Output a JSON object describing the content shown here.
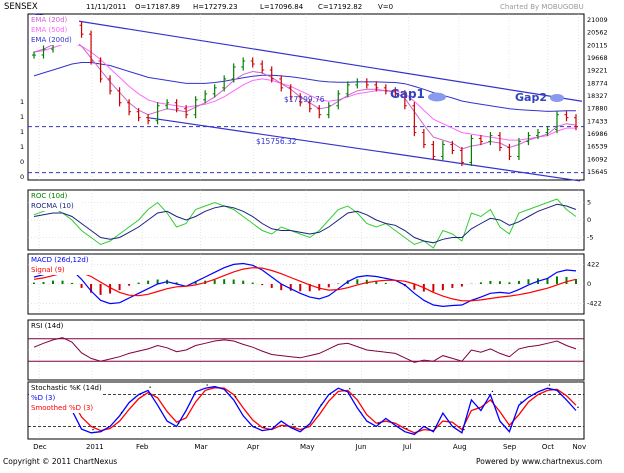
{
  "header": {
    "symbol": "SENSEX",
    "date": "11/11/2011",
    "open": "O=17187.89",
    "high": "H=17279.23",
    "low": "L=17096.84",
    "close": "C=17192.82",
    "volume": "V=0",
    "credit": "Charted By MOBUGOBU"
  },
  "footer": {
    "copyright": "Copyright © 2011 ChartNexus",
    "powered": "Powered by www.chartnexus.com"
  },
  "colors": {
    "price_up": "#008000",
    "price_down": "#cc0000",
    "ema20": "#cc66cc",
    "ema50": "#ff66ff",
    "ema200": "#3333cc",
    "trendline": "#3333cc",
    "roc": "#33cc33",
    "rocma": "#1a237e",
    "macd": "#0000ff",
    "signal": "#ff0000",
    "rsi": "#800040",
    "stoch_k": "#0000ff",
    "stoch_d": "#ff0000",
    "gap_marker": "#8899ee"
  },
  "chart_data": [
    {
      "type": "line",
      "panel": "price",
      "title": "SENSEX",
      "legend": [
        "EMA (20d)",
        "EMA (50d)",
        "EMA (200d)"
      ],
      "yticks": [
        "21009",
        "20562",
        "20115",
        "19668",
        "19221",
        "18774",
        "18327",
        "17880",
        "17433",
        "16986",
        "16539",
        "16092",
        "15645"
      ],
      "ylim": [
        15645,
        21009
      ],
      "left_ticks": [
        "1",
        "1",
        "1",
        "1",
        "0",
        "0"
      ],
      "xticks": [
        "Dec",
        "2011",
        "Feb",
        "Mar",
        "Apr",
        "May",
        "Jun",
        "Jul",
        "Aug",
        "Sep",
        "Oct",
        "Nov"
      ],
      "annotations": [
        "Gap1",
        "Gap2",
        "$17299.76",
        "$15756.32"
      ],
      "levels": [
        17299.76,
        15756.32
      ],
      "close": [
        19700,
        19900,
        20200,
        20500,
        20700,
        20400,
        19500,
        18900,
        18500,
        18100,
        17800,
        17600,
        17500,
        18000,
        18100,
        17900,
        17700,
        18200,
        18400,
        18600,
        18900,
        19300,
        19500,
        19400,
        19200,
        18900,
        18600,
        18300,
        18100,
        17900,
        17700,
        18000,
        18400,
        18700,
        18800,
        18700,
        18600,
        18500,
        18400,
        18000,
        17100,
        16700,
        16300,
        16700,
        16500,
        16100,
        16900,
        16800,
        17000,
        16600,
        16300,
        16800,
        17000,
        17100,
        17200,
        17700,
        17600,
        17300
      ],
      "ema20": [
        19800,
        19900,
        20050,
        20200,
        20250,
        20000,
        19600,
        19200,
        18800,
        18450,
        18100,
        17850,
        17700,
        17800,
        17900,
        17850,
        17800,
        17950,
        18100,
        18300,
        18550,
        18850,
        19050,
        19150,
        19100,
        18950,
        18750,
        18550,
        18300,
        18100,
        17900,
        17950,
        18150,
        18350,
        18500,
        18550,
        18550,
        18500,
        18450,
        18250,
        17800,
        17350,
        16950,
        16850,
        16750,
        16550,
        16650,
        16700,
        16800,
        16750,
        16600,
        16700,
        16850,
        16950,
        17050,
        17300,
        17400,
        17350
      ],
      "ema50": [
        19800,
        19850,
        19950,
        20050,
        20100,
        20000,
        19800,
        19550,
        19250,
        18950,
        18650,
        18400,
        18200,
        18100,
        18050,
        18000,
        17950,
        18000,
        18050,
        18150,
        18300,
        18500,
        18700,
        18850,
        18900,
        18850,
        18750,
        18650,
        18500,
        18350,
        18200,
        18150,
        18200,
        18300,
        18400,
        18450,
        18500,
        18500,
        18500,
        18400,
        18150,
        17850,
        17550,
        17400,
        17250,
        17100,
        17050,
        17000,
        16950,
        16900,
        16850,
        16850,
        16900,
        16950,
        17000,
        17150,
        17250,
        17250
      ],
      "ema200": [
        19000,
        19100,
        19200,
        19300,
        19400,
        19450,
        19450,
        19400,
        19350,
        19250,
        19150,
        19050,
        18950,
        18900,
        18850,
        18800,
        18750,
        18750,
        18750,
        18780,
        18820,
        18880,
        18940,
        18990,
        19020,
        19020,
        19000,
        18970,
        18930,
        18880,
        18830,
        18800,
        18790,
        18790,
        18800,
        18800,
        18800,
        18790,
        18780,
        18740,
        18650,
        18550,
        18440,
        18350,
        18260,
        18160,
        18100,
        18050,
        18000,
        17950,
        17900,
        17870,
        17850,
        17830,
        17810,
        17820,
        17830,
        17830
      ]
    },
    {
      "type": "line",
      "panel": "roc",
      "legend": [
        "ROC (10d)",
        "ROCMA (10)"
      ],
      "yticks": [
        "5",
        "0",
        "-5"
      ],
      "ylim": [
        -8,
        8
      ],
      "roc": [
        1.5,
        2.5,
        3.5,
        2,
        0,
        -3,
        -5,
        -7,
        -6,
        -4,
        -2,
        0,
        3,
        5,
        2,
        -2,
        -1,
        3,
        4,
        5,
        4,
        3,
        1,
        -1,
        -3,
        -4,
        -2,
        -3,
        -4,
        -5,
        -3,
        0,
        3,
        4,
        2,
        -1,
        -2,
        -1,
        -3,
        -5,
        -7,
        -6,
        -8,
        -3,
        -4,
        -6,
        2,
        1,
        3,
        -2,
        -4,
        2,
        3,
        4,
        5,
        6,
        3,
        1
      ],
      "rocma": [
        1,
        1.5,
        2,
        2,
        1,
        -1,
        -3,
        -5,
        -5.5,
        -5,
        -3.5,
        -2,
        0,
        2,
        2.5,
        1,
        0,
        1,
        2.5,
        3.5,
        4,
        3.5,
        2.5,
        1,
        -1,
        -2.5,
        -3,
        -3,
        -3.5,
        -4,
        -3.5,
        -2,
        0,
        2,
        2.5,
        1.5,
        0,
        -1,
        -1.5,
        -3,
        -5,
        -6,
        -6.5,
        -5.5,
        -5,
        -5,
        -2.5,
        -1,
        0.5,
        0,
        -1.5,
        -0.5,
        1,
        2.5,
        3.5,
        4.5,
        4,
        3
      ]
    },
    {
      "type": "bar",
      "panel": "macd",
      "legend": [
        "MACD (26d,12d)",
        "Signal (9)"
      ],
      "yticks": [
        "422",
        "0",
        "-422"
      ],
      "ylim": [
        -600,
        600
      ],
      "macd": [
        150,
        200,
        300,
        350,
        300,
        100,
        -150,
        -350,
        -420,
        -400,
        -300,
        -200,
        -100,
        0,
        50,
        0,
        -50,
        50,
        150,
        250,
        350,
        420,
        440,
        400,
        300,
        150,
        0,
        -100,
        -200,
        -280,
        -320,
        -250,
        -100,
        50,
        150,
        180,
        160,
        120,
        80,
        -20,
        -200,
        -350,
        -450,
        -480,
        -460,
        -450,
        -350,
        -280,
        -200,
        -180,
        -200,
        -120,
        -20,
        60,
        120,
        250,
        300,
        280
      ],
      "signal": [
        100,
        130,
        180,
        230,
        260,
        240,
        160,
        40,
        -80,
        -180,
        -240,
        -250,
        -220,
        -160,
        -100,
        -60,
        -50,
        -20,
        30,
        100,
        180,
        260,
        320,
        350,
        340,
        290,
        220,
        140,
        60,
        -20,
        -90,
        -130,
        -120,
        -80,
        -20,
        30,
        60,
        80,
        80,
        60,
        0,
        -80,
        -180,
        -260,
        -320,
        -360,
        -360,
        -340,
        -310,
        -280,
        -260,
        -230,
        -190,
        -140,
        -90,
        -20,
        50,
        100
      ]
    },
    {
      "type": "line",
      "panel": "rsi",
      "legend": [
        "RSI (14d)"
      ],
      "ylim": [
        0,
        100
      ],
      "levels": [
        30,
        70
      ],
      "rsi": [
        55,
        62,
        68,
        72,
        64,
        45,
        35,
        30,
        34,
        38,
        44,
        48,
        52,
        58,
        54,
        47,
        50,
        58,
        62,
        66,
        68,
        66,
        60,
        55,
        48,
        42,
        40,
        38,
        36,
        40,
        44,
        52,
        60,
        62,
        56,
        50,
        48,
        46,
        44,
        36,
        28,
        32,
        30,
        40,
        35,
        30,
        50,
        46,
        52,
        44,
        38,
        52,
        56,
        58,
        62,
        66,
        58,
        52
      ]
    },
    {
      "type": "line",
      "panel": "stochastic",
      "legend": [
        "Stochastic %K (14d)",
        "%D (3)",
        "Smoothed %D (3)"
      ],
      "ylim": [
        0,
        100
      ],
      "levels": [
        20,
        80
      ],
      "k": [
        60,
        85,
        95,
        90,
        50,
        15,
        8,
        10,
        20,
        40,
        65,
        80,
        88,
        60,
        30,
        20,
        50,
        85,
        92,
        95,
        90,
        70,
        40,
        20,
        12,
        15,
        30,
        18,
        10,
        25,
        55,
        80,
        92,
        85,
        55,
        30,
        20,
        35,
        22,
        10,
        5,
        20,
        10,
        45,
        20,
        8,
        70,
        50,
        80,
        30,
        10,
        60,
        75,
        85,
        92,
        88,
        70,
        50
      ],
      "d": [
        55,
        75,
        88,
        92,
        70,
        38,
        20,
        12,
        16,
        30,
        52,
        72,
        84,
        74,
        48,
        28,
        36,
        66,
        88,
        93,
        92,
        80,
        55,
        32,
        18,
        14,
        22,
        20,
        14,
        20,
        42,
        68,
        86,
        88,
        70,
        42,
        26,
        30,
        26,
        16,
        8,
        14,
        12,
        30,
        28,
        14,
        50,
        56,
        70,
        48,
        22,
        42,
        66,
        80,
        88,
        90,
        78,
        60
      ]
    }
  ]
}
